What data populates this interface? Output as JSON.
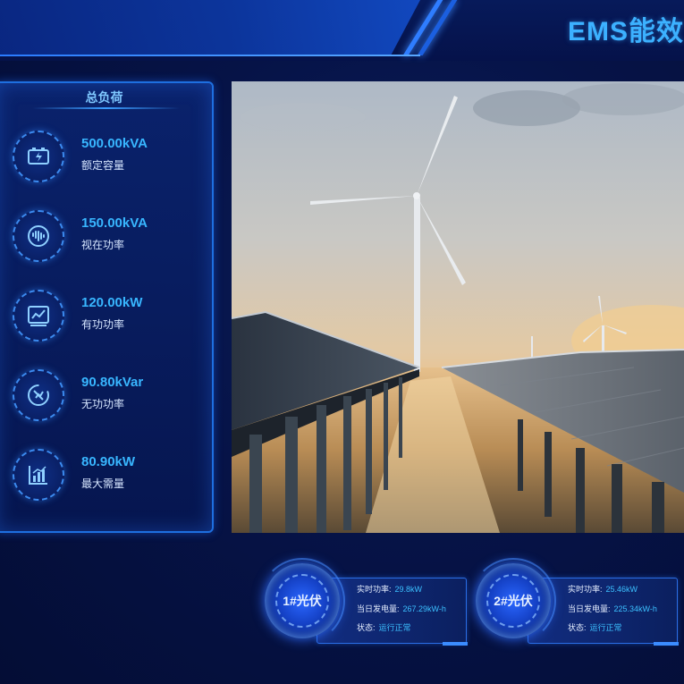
{
  "header": {
    "title": "EMS能效"
  },
  "load_panel": {
    "title": "总负荷",
    "metrics": [
      {
        "icon": "battery-icon",
        "value": "500.00kVA",
        "label": "额定容量"
      },
      {
        "icon": "waveform-icon",
        "value": "150.00kVA",
        "label": "视在功率"
      },
      {
        "icon": "line-chart-icon",
        "value": "120.00kW",
        "label": "有功功率"
      },
      {
        "icon": "gauge-icon",
        "value": "90.80kVar",
        "label": "无功功率"
      },
      {
        "icon": "bar-chart-icon",
        "value": "80.90kW",
        "label": "最大需量"
      }
    ]
  },
  "pv_units": [
    {
      "name": "1#光伏",
      "realtime_power_label": "实时功率:",
      "realtime_power": "29.8kW",
      "daily_gen_label": "当日发电量:",
      "daily_gen": "267.29kW-h",
      "status_label": "状态:",
      "status": "运行正常"
    },
    {
      "name": "2#光伏",
      "realtime_power_label": "实时功率:",
      "realtime_power": "25.46kW",
      "daily_gen_label": "当日发电量:",
      "daily_gen": "225.34kW-h",
      "status_label": "状态:",
      "status": "运行正常"
    }
  ],
  "colors": {
    "accent": "#38b6ff",
    "title": "#3cb1ff",
    "background": "#061347"
  }
}
